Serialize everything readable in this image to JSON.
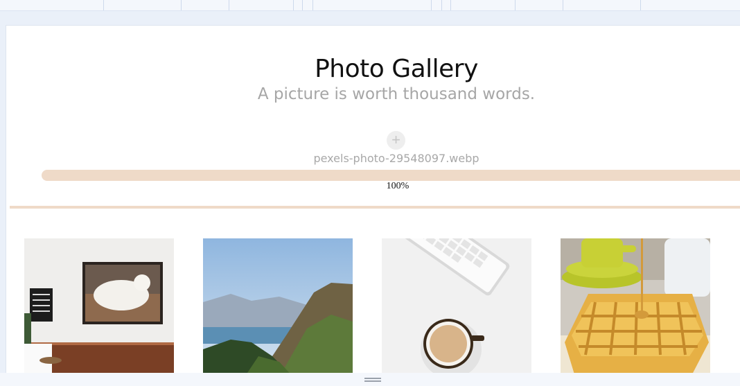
{
  "gallery": {
    "title": "Photo Gallery",
    "subtitle": "A picture is worth thousand words.",
    "add_icon": "+"
  },
  "upload": {
    "file_name": "pexels-photo-29548097.webp",
    "progress": 1.0,
    "progress_text": "100%"
  },
  "colors": {
    "progress": "#efdac8",
    "background": "#eaf0f9"
  },
  "photos": [
    {
      "name": "white cat painting on wall"
    },
    {
      "name": "mountain lake landscape"
    },
    {
      "name": "keyboard and coffee cup"
    },
    {
      "name": "waffles with syrup"
    }
  ]
}
